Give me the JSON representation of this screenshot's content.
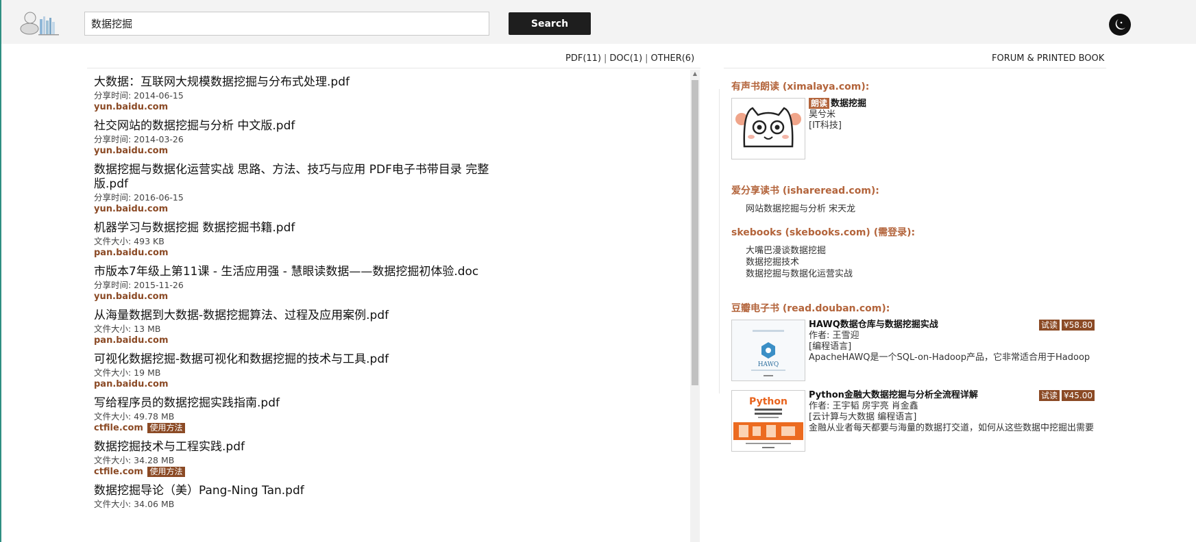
{
  "header": {
    "logo_icon": "bookshelf-logo-icon",
    "search_value": "数据挖掘",
    "search_button": "Search",
    "theme_icon": "moon-icon"
  },
  "filters": {
    "pdf": "PDF(11)",
    "doc": "DOC(1)",
    "other": "OTHER(6)",
    "separator": "|"
  },
  "results": [
    {
      "title": "大数据：互联网大规模数据挖掘与分布式处理.pdf",
      "meta": "分享时间: 2014-06-15",
      "source": "yun.baidu.com"
    },
    {
      "title": "社交网站的数据挖掘与分析 中文版.pdf",
      "meta": "分享时间: 2014-03-26",
      "source": "yun.baidu.com"
    },
    {
      "title": "数据挖掘与数据化运营实战 思路、方法、技巧与应用 PDF电子书带目录 完整版.pdf",
      "meta": "分享时间: 2016-06-15",
      "source": "yun.baidu.com"
    },
    {
      "title": "机器学习与数据挖掘 数据挖掘书籍.pdf",
      "meta": "文件大小: 493 KB",
      "source": "pan.baidu.com"
    },
    {
      "title": "市版本7年级上第11课 - 生活应用强 - 慧眼读数据——数据挖掘初体验.doc",
      "meta": "分享时间: 2015-11-26",
      "source": "yun.baidu.com"
    },
    {
      "title": "从海量数据到大数据-数据挖掘算法、过程及应用案例.pdf",
      "meta": "文件大小: 13 MB",
      "source": "pan.baidu.com"
    },
    {
      "title": "可视化数据挖掘-数据可视化和数据挖掘的技术与工具.pdf",
      "meta": "文件大小: 19 MB",
      "source": "pan.baidu.com"
    },
    {
      "title": "写给程序员的数据挖掘实践指南.pdf",
      "meta": "文件大小: 49.78 MB",
      "source": "ctfile.com",
      "badge": "使用方法"
    },
    {
      "title": "数据挖掘技术与工程实践.pdf",
      "meta": "文件大小: 34.28 MB",
      "source": "ctfile.com",
      "badge": "使用方法"
    },
    {
      "title": "数据挖掘导论（美）Pang-Ning Tan.pdf",
      "meta": "文件大小: 34.06 MB",
      "source": ""
    }
  ],
  "sidebar": {
    "forum_link": "FORUM & PRINTED BOOK",
    "ximalaya": {
      "title": "有声书朗读 (ximalaya.com):",
      "tag": "朗读",
      "book_title": "数据挖掘",
      "author": "昊兮米",
      "category": "[IT科技]",
      "cover_icon": "cat-face-cover-icon"
    },
    "ishareread": {
      "title": "爱分享读书 (ishareread.com):",
      "items": [
        "网站数据挖掘与分析 宋天龙"
      ]
    },
    "skebooks": {
      "title": "skebooks (skebooks.com) (需登录):",
      "items": [
        "大嘴巴漫谈数据挖掘",
        "数据挖掘技术",
        "数据挖掘与数据化运营实战"
      ]
    },
    "douban": {
      "title": "豆瓣电子书 (read.douban.com):",
      "books": [
        {
          "title": "HAWQ数据仓库与数据挖掘实战",
          "author": "作者: 王雪迎",
          "category": "[编程语言]",
          "desc": "ApacheHAWQ是一个SQL-on-Hadoop产品，它非常适合用于Hadoop",
          "trial": "试读",
          "price": "¥58.80",
          "cover_text": "HAWQ",
          "cover_icon": "hawq-book-cover-icon"
        },
        {
          "title": "Python金融大数据挖掘与分析全流程详解",
          "author": "作者: 王宇韬 房宇亮 肖金鑫",
          "category": "[云计算与大数据 编程语言]",
          "desc": "金融从业者每天都要与海量的数据打交道，如何从这些数据中挖掘出需要",
          "trial": "试读",
          "price": "¥45.00",
          "cover_text": "Python",
          "cover_icon": "python-book-cover-icon"
        }
      ]
    }
  },
  "colors": {
    "accent_brown": "#8b4a25",
    "section_title": "#b3643b",
    "button_dark": "#1e1e1e"
  }
}
